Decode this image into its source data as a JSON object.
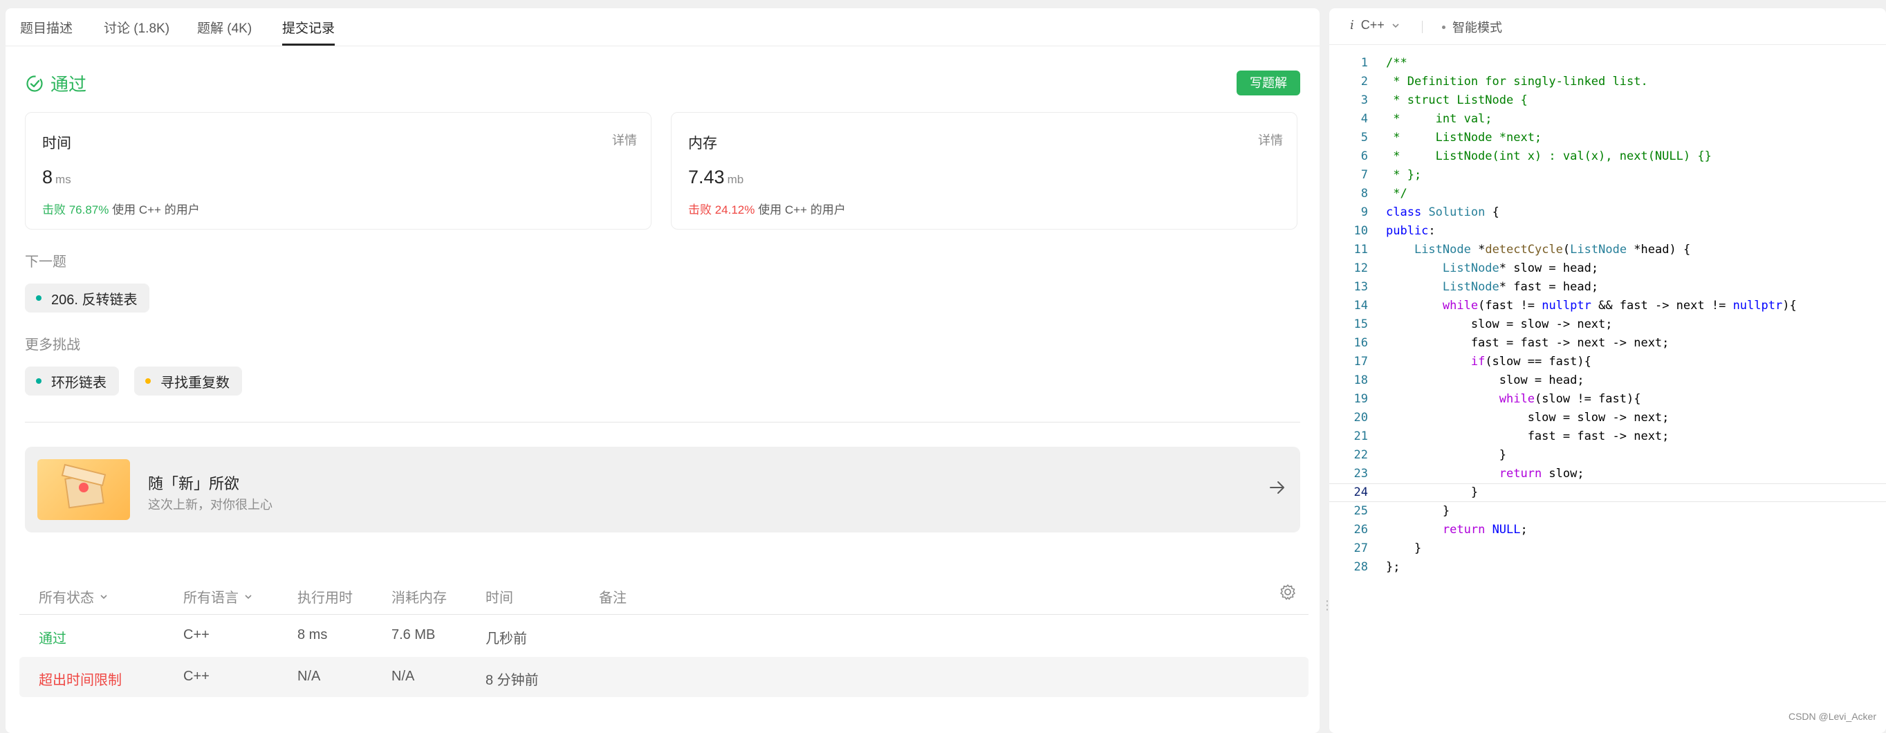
{
  "tabs": [
    "题目描述",
    "讨论 (1.8K)",
    "题解 (4K)",
    "提交记录"
  ],
  "status": "通过",
  "write_solution_button": "写题解",
  "time_card": {
    "title": "时间",
    "detail": "详情",
    "value": "8",
    "unit": "ms",
    "beat": "击败 76.87%",
    "beat_suffix": "使用 C++ 的用户"
  },
  "memory_card": {
    "title": "内存",
    "detail": "详情",
    "value": "7.43",
    "unit": "mb",
    "beat": "击败 24.12%",
    "beat_suffix": "使用 C++ 的用户"
  },
  "next_problem": {
    "label": "下一题",
    "item": "206. 反转链表",
    "dot_color": "#2db55d"
  },
  "more_challenges": {
    "label": "更多挑战",
    "items": [
      {
        "text": "环形链表",
        "dot_color": "#00af9b"
      },
      {
        "text": "寻找重复数",
        "dot_color": "#ffb800"
      }
    ]
  },
  "banner": {
    "title": "随「新」所欲",
    "subtitle": "这次上新，对你很上心",
    "icon": "arrow-right-icon"
  },
  "table": {
    "headers": [
      "所有状态",
      "所有语言",
      "执行用时",
      "消耗内存",
      "时间",
      "备注"
    ],
    "rows": [
      {
        "status": "通过",
        "status_color": "#2db55d",
        "lang": "C++",
        "runtime": "8 ms",
        "memory": "7.6 MB",
        "time": "几秒前",
        "note": ""
      },
      {
        "status": "超出时间限制",
        "status_color": "#ef4743",
        "lang": "C++",
        "runtime": "N/A",
        "memory": "N/A",
        "time": "8 分钟前",
        "note": ""
      }
    ]
  },
  "editor": {
    "language": "C++",
    "mode": "智能模式",
    "current_line": 24,
    "watermark": "CSDN @Levi_Acker"
  },
  "code_lines": [
    "/**",
    " * Definition for singly-linked list.",
    " * struct ListNode {",
    " *     int val;",
    " *     ListNode *next;",
    " *     ListNode(int x) : val(x), next(NULL) {}",
    " * };",
    " */",
    "class Solution {",
    "public:",
    "    ListNode *detectCycle(ListNode *head) {",
    "        ListNode* slow = head;",
    "        ListNode* fast = head;",
    "        while(fast != nullptr && fast -> next != nullptr){",
    "            slow = slow -> next;",
    "            fast = fast -> next -> next;",
    "            if(slow == fast){",
    "                slow = head;",
    "                while(slow != fast){",
    "                    slow = slow -> next;",
    "                    fast = fast -> next;",
    "                }",
    "                return slow;",
    "            }",
    "        }",
    "        return NULL;",
    "    }",
    "};"
  ]
}
